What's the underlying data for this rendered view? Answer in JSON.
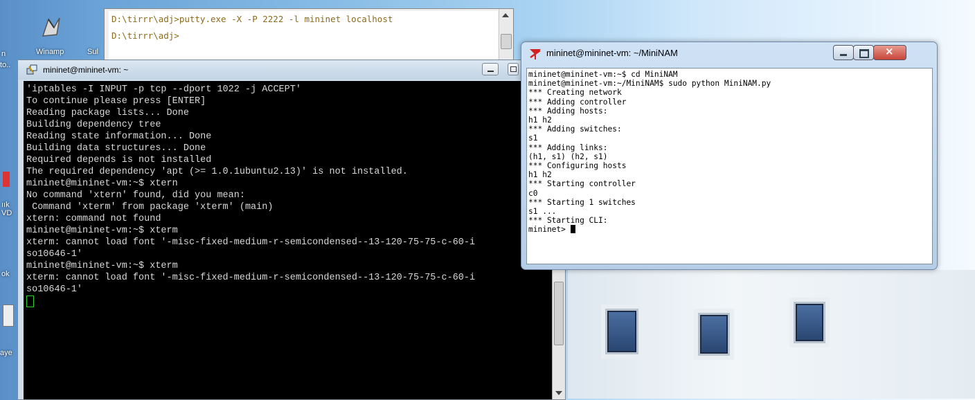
{
  "desktop": {
    "icons": [
      {
        "name": "winamp-icon",
        "label": "Winamp"
      },
      {
        "name": "sub-icon",
        "label": "Sul"
      }
    ],
    "left_labels": [
      "n",
      "to..",
      "ıık",
      "VD",
      "ok",
      "aye"
    ]
  },
  "cmd": {
    "lines": [
      "D:\\tirrr\\adj>putty.exe -X -P 2222 -l mininet localhost",
      "D:\\tirrr\\adj>"
    ]
  },
  "putty": {
    "title": "mininet@mininet-vm: ~",
    "lines": [
      "'iptables -I INPUT -p tcp --dport 1022 -j ACCEPT'",
      "",
      "To continue please press [ENTER]",
      "",
      "Reading package lists... Done",
      "Building dependency tree",
      "Reading state information... Done",
      "Building data structures... Done",
      "",
      "Required depends is not installed",
      "",
      "The required dependency 'apt (>= 1.0.1ubuntu2.13)' is not installed.",
      "",
      "mininet@mininet-vm:~$ xtern",
      "No command 'xtern' found, did you mean:",
      " Command 'xterm' from package 'xterm' (main)",
      "xtern: command not found",
      "mininet@mininet-vm:~$ xterm",
      "xterm: cannot load font '-misc-fixed-medium-r-semicondensed--13-120-75-75-c-60-i",
      "so10646-1'",
      "mininet@mininet-vm:~$ xterm",
      "xterm: cannot load font '-misc-fixed-medium-r-semicondensed--13-120-75-75-c-60-i",
      "so10646-1'"
    ],
    "cursor_color": "#33cc33"
  },
  "xterm": {
    "title": "mininet@mininet-vm: ~/MiniNAM",
    "lines": [
      "mininet@mininet-vm:~$ cd MiniNAM",
      "mininet@mininet-vm:~/MiniNAM$ sudo python MiniNAM.py",
      "*** Creating network",
      "*** Adding controller",
      "*** Adding hosts:",
      "h1 h2",
      "*** Adding switches:",
      "s1",
      "*** Adding links:",
      "(h1, s1) (h2, s1)",
      "*** Configuring hosts",
      "h1 h2",
      "*** Starting controller",
      "c0",
      "*** Starting 1 switches",
      "s1 ...",
      "*** Starting CLI:",
      "mininet> "
    ],
    "close_color": "#c8453a"
  }
}
